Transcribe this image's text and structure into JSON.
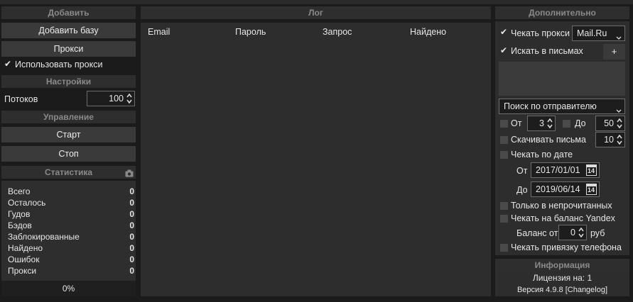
{
  "left": {
    "add_header": "Добавить",
    "add_base_label": "Добавить базу",
    "proxy_label": "Прокси",
    "use_proxy_label": "Использовать прокси",
    "use_proxy_checked": true,
    "settings_header": "Настройки",
    "threads_label": "Потоков",
    "threads_value": "100",
    "control_header": "Управление",
    "start_label": "Старт",
    "stop_label": "Стоп",
    "stats_header": "Статистика",
    "stats": [
      {
        "label": "Всего",
        "value": "0"
      },
      {
        "label": "Осталось",
        "value": "0"
      },
      {
        "label": "Гудов",
        "value": "0"
      },
      {
        "label": "Бэдов",
        "value": "0"
      },
      {
        "label": "Заблокированные",
        "value": "0"
      },
      {
        "label": "Найдено",
        "value": "0"
      },
      {
        "label": "Ошибок",
        "value": "0"
      },
      {
        "label": "Прокси",
        "value": "0"
      }
    ],
    "progress_text": "0%"
  },
  "log": {
    "header": "Лог",
    "columns": [
      "Email",
      "Пароль",
      "Запрос",
      "Найдено"
    ]
  },
  "extra": {
    "header": "Дополнительно",
    "check_proxy_label": "Чекать прокси",
    "check_proxy_checked": true,
    "provider_value": "Mail.Ru",
    "search_mails_label": "Искать в письмах",
    "search_mails_checked": true,
    "add_button_label": "+",
    "search_mode_value": "Поиск по отправителю",
    "from_label": "От",
    "from_value": "3",
    "to_label": "До",
    "to_value": "50",
    "download_mails_label": "Скачивать письма",
    "download_value": "10",
    "check_by_date_label": "Чекать по дате",
    "date_from_label": "От",
    "date_from_value": "2017/01/01",
    "date_to_label": "До",
    "date_to_value": "2019/06/14",
    "calendar_day": "14",
    "unread_only_label": "Только в непрочитанных",
    "yandex_balance_label": "Чекать на баланс Yandex",
    "balance_from_label": "Баланс от",
    "balance_value": "0",
    "currency_label": "руб",
    "phone_binding_label": "Чекать привязку телефона"
  },
  "info": {
    "header": "Информация",
    "license_text": "Лицензия на: 1",
    "version_text": "Версия 4.9.8 [Changelog]"
  }
}
